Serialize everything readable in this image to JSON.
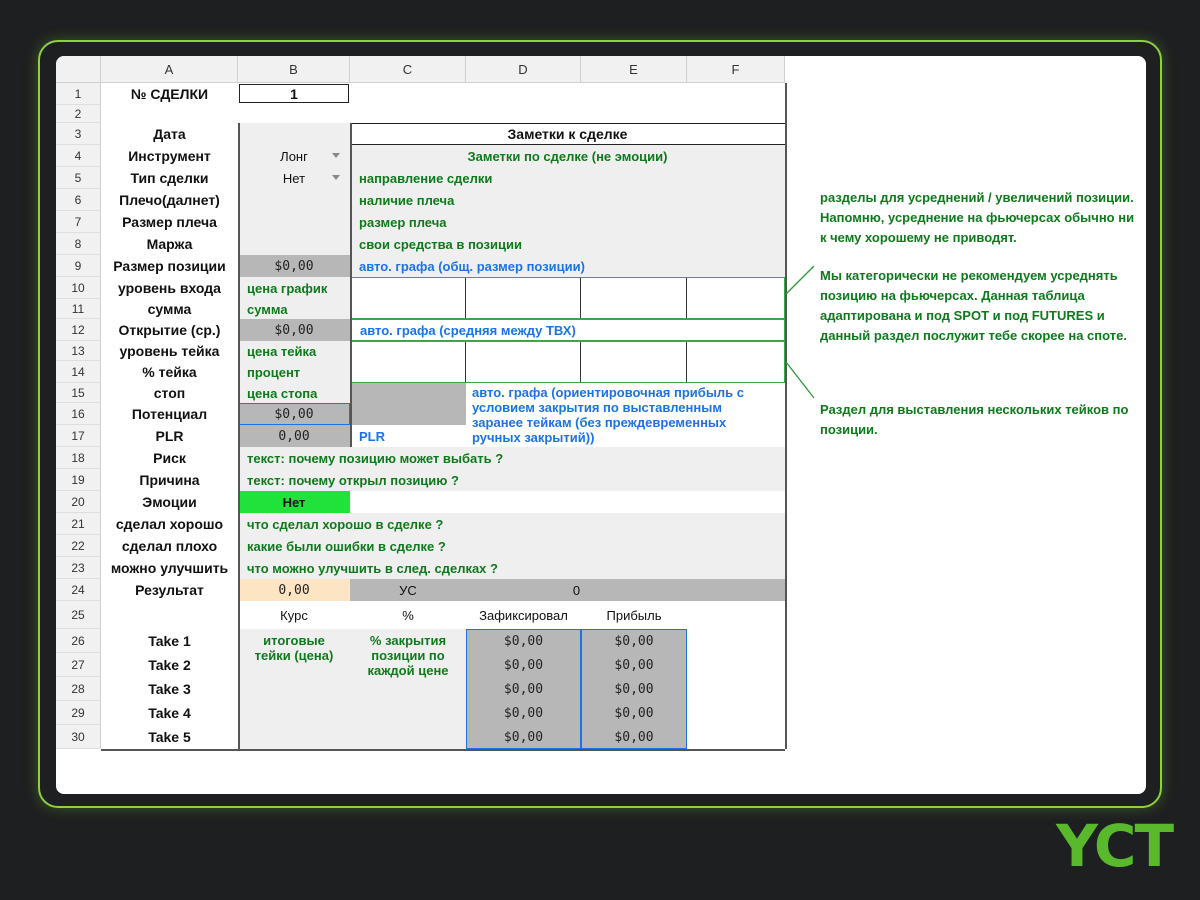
{
  "columns": [
    "A",
    "B",
    "C",
    "D",
    "E",
    "F"
  ],
  "rows": [
    "1",
    "2",
    "3",
    "4",
    "5",
    "6",
    "7",
    "8",
    "9",
    "10",
    "11",
    "12",
    "13",
    "14",
    "15",
    "16",
    "17",
    "18",
    "19",
    "20",
    "21",
    "22",
    "23",
    "24",
    "25",
    "26",
    "27",
    "28",
    "29",
    "30"
  ],
  "cells": {
    "a1": "№ СДЕЛКИ",
    "b1": "1",
    "a3": "Дата",
    "notes_title": "Заметки к сделке",
    "a4": "Инструмент",
    "b4": "Лонг",
    "c4": "Заметки по сделке (не эмоции)",
    "a5": "Тип сделки",
    "b5": "Нет",
    "c5": "направление сделки",
    "a6": "Плечо(далнет)",
    "c6": "наличие плеча",
    "a7": "Размер плеча",
    "c7": "размер плеча",
    "a8": "Маржа",
    "c8": "свои средства в позиции",
    "a9": "Размер позиции",
    "b9": "$0,00",
    "c9": "авто. графа (общ. размер позиции)",
    "a10": "уровень входа",
    "b10": "цена график",
    "a11": "сумма",
    "b11": "сумма",
    "a12": "Открытие (ср.)",
    "b12": "$0,00",
    "c12": "авто. графа (средняя между ТВХ)",
    "a13": "уровень тейка",
    "b13": "цена тейка",
    "a14": "% тейка",
    "b14": "процент",
    "a15": "стоп",
    "b15": "цена стопа",
    "d15": "авто. графа (ориентировочная прибыль с условием закрытия по выставленным заранее тейкам (без преждевременных ручных закрытий))",
    "a16": "Потенциал",
    "b16": "$0,00",
    "a17": "PLR",
    "b17": "0,00",
    "c17": "PLR",
    "a18": "Риск",
    "b18": "текст: почему позицию может выбать ?",
    "a19": "Причина",
    "b19": "текст: почему открыл позицию ?",
    "a20": "Эмоции",
    "b20": "Нет",
    "a21": "сделал хорошо",
    "b21": "что сделал хорошо в сделке ?",
    "a22": "сделал плохо",
    "b22": "какие были ошибки в сделке ?",
    "a23": "можно улучшить",
    "b23": "что можно улучшить в след. сделках ?",
    "a24": "Результат",
    "b24": "0,00",
    "c24": "УС",
    "d24": "0",
    "b25": "Курс",
    "c25": "%",
    "d25": "Зафиксировал",
    "e25": "Прибыль",
    "b26": "итоговые тейки (цена)",
    "c26": "% закрытия позиции по каждой цене"
  },
  "takes": [
    {
      "label": "Take 1",
      "fixed": "$0,00",
      "profit": "$0,00"
    },
    {
      "label": "Take 2",
      "fixed": "$0,00",
      "profit": "$0,00"
    },
    {
      "label": "Take 3",
      "fixed": "$0,00",
      "profit": "$0,00"
    },
    {
      "label": "Take 4",
      "fixed": "$0,00",
      "profit": "$0,00"
    },
    {
      "label": "Take 5",
      "fixed": "$0,00",
      "profit": "$0,00"
    }
  ],
  "annotations": {
    "note1": "разделы для усреднений / увеличений позиции. Напомню, усреднение на фьючерсах обычно ни к чему хорошему не приводят.",
    "note2": "Мы категорически не рекомендуем усреднять позицию на фьючерсах. Данная таблица адаптирована и под SPOT и под FUTURES и данный раздел послужит тебе скорее на споте.",
    "note3": "Раздел для выставления нескольких тейков по позиции."
  },
  "logo_text": "YCT",
  "colors": {
    "frame": "#8ed13a",
    "green_text": "#0f7a1c",
    "blue_text": "#1a73e8",
    "emotion_bg": "#21e23b",
    "result_bg": "#fde5c4",
    "dark_grey": "#b7b7b7",
    "light_grey": "#efefef"
  }
}
